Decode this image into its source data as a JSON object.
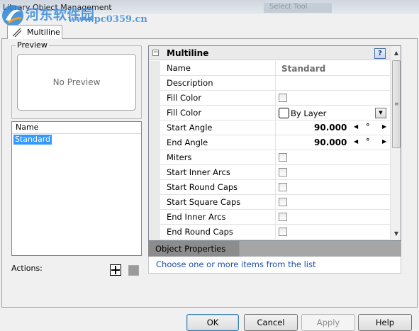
{
  "window": {
    "title": "Library Object Management",
    "behind_title": "Select Tool",
    "watermark": "河东软件园",
    "watermark_url": "www.pc0359.cn"
  },
  "tab": {
    "label": "Multiline"
  },
  "preview": {
    "legend": "Preview",
    "placeholder": "No Preview"
  },
  "list": {
    "header": "Name",
    "items": [
      "Standard"
    ]
  },
  "actions": {
    "label": "Actions:"
  },
  "properties": {
    "title": "Multiline",
    "help": "?",
    "rows": [
      {
        "name": "Name",
        "value": "Standard"
      },
      {
        "name": "Description",
        "value": ""
      },
      {
        "name": "Fill Color",
        "checked": false
      },
      {
        "name": "Fill Color",
        "value": "By Layer"
      },
      {
        "name": "Start Angle",
        "value": "90.000",
        "unit": "°"
      },
      {
        "name": "End Angle",
        "value": "90.000",
        "unit": "°"
      },
      {
        "name": "Miters",
        "checked": false
      },
      {
        "name": "Start Inner Arcs",
        "checked": false
      },
      {
        "name": "Start Round Caps",
        "checked": false
      },
      {
        "name": "Start Square Caps",
        "checked": false
      },
      {
        "name": "End Inner Arcs",
        "checked": false
      },
      {
        "name": "End Round Caps",
        "checked": false
      }
    ]
  },
  "object_properties": {
    "header": "Object Properties",
    "hint": "Choose one or more items from the list"
  },
  "buttons": {
    "ok": "OK",
    "cancel": "Cancel",
    "apply": "Apply",
    "help": "Help"
  },
  "colors": {
    "selection": "#3399ff",
    "hint_link": "#1e4fa8",
    "watermark": "#3b8cd9"
  }
}
